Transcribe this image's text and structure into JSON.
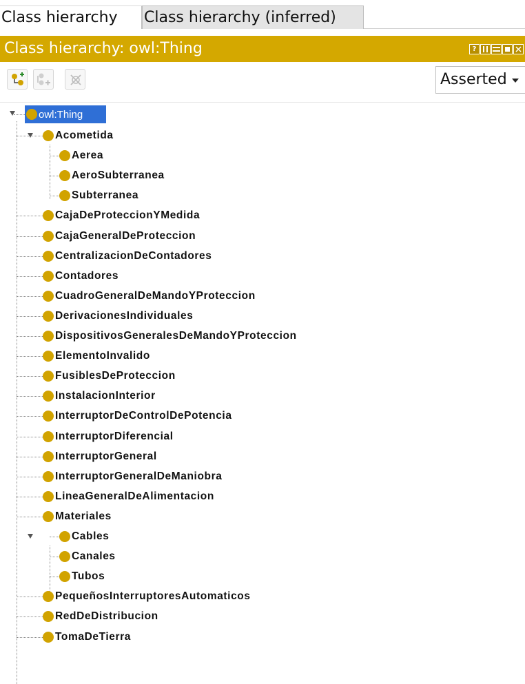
{
  "tabs": [
    {
      "label": "Class hierarchy",
      "active": true
    },
    {
      "label": "Class hierarchy (inferred)",
      "active": false
    }
  ],
  "panel": {
    "title": "Class hierarchy: owl:Thing",
    "accent_color": "#d4a800",
    "window_buttons": [
      "help",
      "pin",
      "split",
      "maximize",
      "close"
    ]
  },
  "toolbar": {
    "buttons": [
      {
        "name": "add-subclass-icon",
        "enabled": true
      },
      {
        "name": "add-sibling-icon",
        "enabled": false
      },
      {
        "name": "delete-class-icon",
        "enabled": false
      }
    ],
    "view_mode": "Asserted"
  },
  "tree": {
    "root": {
      "label": "owl:Thing",
      "selected": true
    },
    "nodes": [
      {
        "label": "Acometida",
        "depth": 1,
        "expanded": true
      },
      {
        "label": "Aerea",
        "depth": 2
      },
      {
        "label": "AeroSubterranea",
        "depth": 2
      },
      {
        "label": "Subterranea",
        "depth": 2
      },
      {
        "label": "CajaDeProteccionYMedida",
        "depth": 1
      },
      {
        "label": "CajaGeneralDeProteccion",
        "depth": 1
      },
      {
        "label": "CentralizacionDeContadores",
        "depth": 1
      },
      {
        "label": "Contadores",
        "depth": 1
      },
      {
        "label": "CuadroGeneralDeMandoYProteccion",
        "depth": 1
      },
      {
        "label": "DerivacionesIndividuales",
        "depth": 1
      },
      {
        "label": "DispositivosGeneralesDeMandoYProteccion",
        "depth": 1
      },
      {
        "label": "ElementoInvalido",
        "depth": 1
      },
      {
        "label": "FusiblesDeProteccion",
        "depth": 1
      },
      {
        "label": "InstalacionInterior",
        "depth": 1
      },
      {
        "label": "InterruptorDeControlDePotencia",
        "depth": 1
      },
      {
        "label": "InterruptorDiferencial",
        "depth": 1
      },
      {
        "label": "InterruptorGeneral",
        "depth": 1
      },
      {
        "label": "InterruptorGeneralDeManiobra",
        "depth": 1
      },
      {
        "label": "LineaGeneralDeAlimentacion",
        "depth": 1
      },
      {
        "label": "Materiales",
        "depth": 1,
        "expanded": true
      },
      {
        "label": "Cables",
        "depth": 2
      },
      {
        "label": "Canales",
        "depth": 2
      },
      {
        "label": "Tubos",
        "depth": 2
      },
      {
        "label": "PequeñosInterruptoresAutomaticos",
        "depth": 1
      },
      {
        "label": "RedDeDistribucion",
        "depth": 1
      },
      {
        "label": "TomaDeTierra",
        "depth": 1
      }
    ]
  }
}
